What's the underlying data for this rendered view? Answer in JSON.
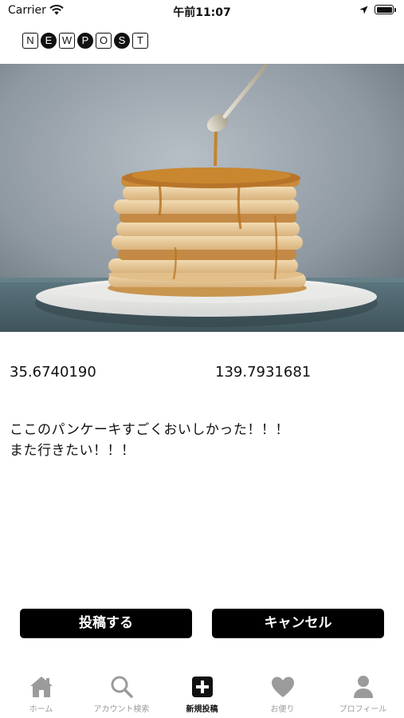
{
  "status_bar": {
    "carrier": "Carrier",
    "time": "午前11:07"
  },
  "header": {
    "title_letters": [
      "N",
      "E",
      "W",
      "P",
      "O",
      "S",
      "T"
    ]
  },
  "post": {
    "latitude": "35.6740190",
    "longitude": "139.7931681",
    "comment": "ここのパンケーキすごくおいしかった！！！\nまた行きたい！！！"
  },
  "actions": {
    "post_label": "投稿する",
    "cancel_label": "キャンセル"
  },
  "tabs": [
    {
      "label": "ホーム",
      "icon": "home-icon",
      "active": false
    },
    {
      "label": "アカウント検索",
      "icon": "search-icon",
      "active": false
    },
    {
      "label": "新規投稿",
      "icon": "plus-square-icon",
      "active": true
    },
    {
      "label": "お便り",
      "icon": "heart-icon",
      "active": false
    },
    {
      "label": "プロフィール",
      "icon": "person-icon",
      "active": false
    }
  ],
  "colors": {
    "accent": "#000000",
    "inactive_tab": "#9b9b9b",
    "background": "#ffffff"
  }
}
